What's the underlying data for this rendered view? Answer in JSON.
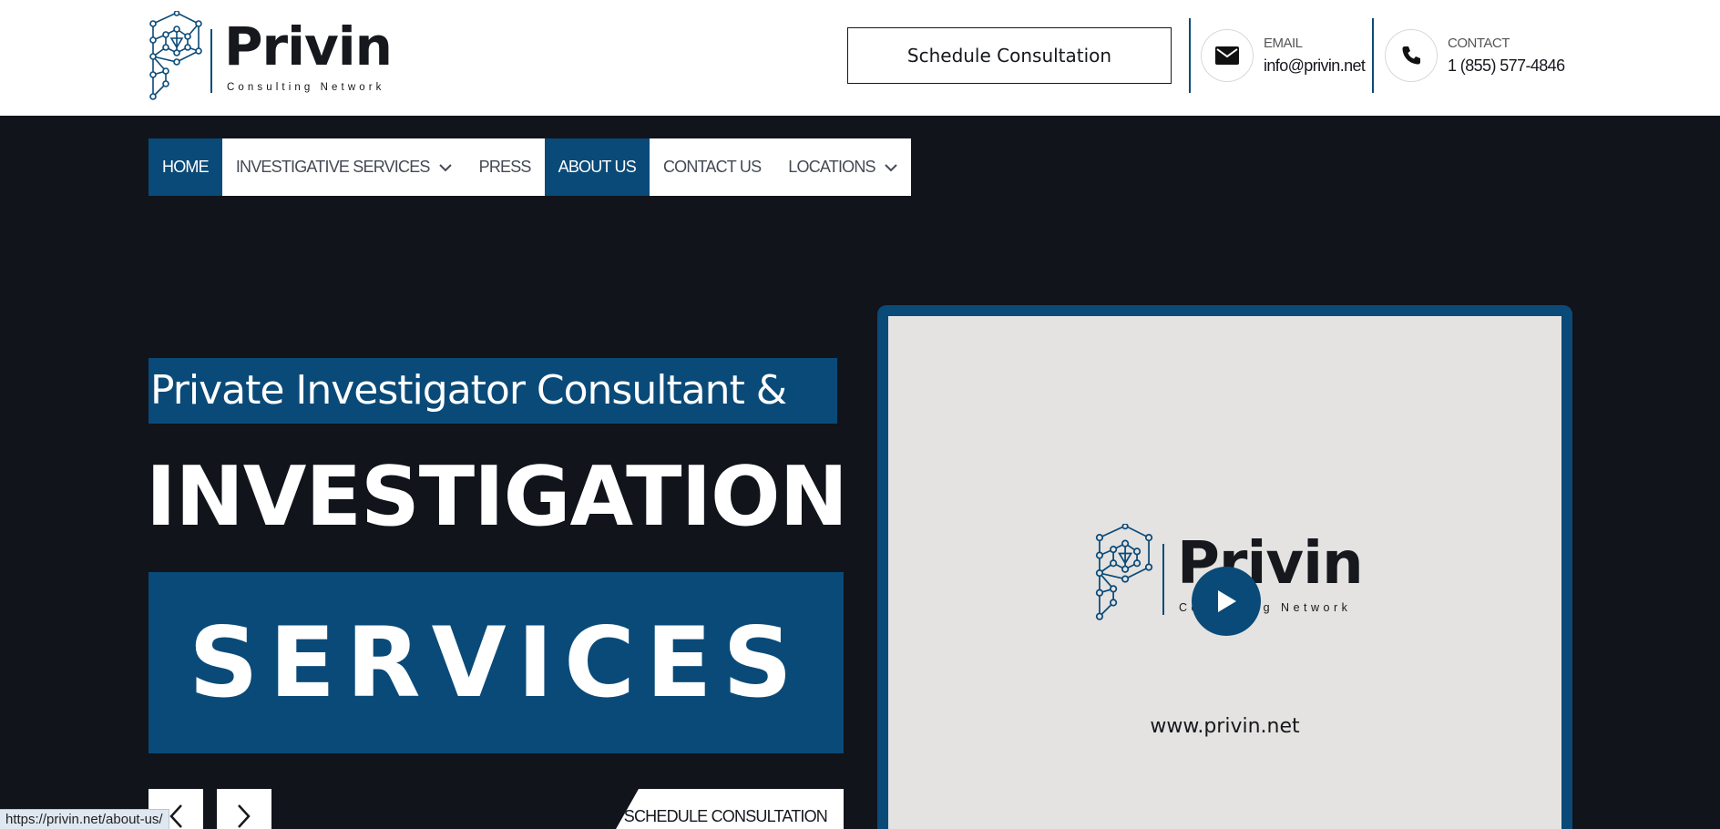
{
  "header": {
    "logo": {
      "name": "Privin",
      "tagline": "Consulting Network"
    },
    "schedule_button": "Schedule Consultation",
    "email": {
      "icon": "mail-icon",
      "label": "EMAIL",
      "value": "info@privin.net"
    },
    "contact": {
      "icon": "phone-icon",
      "label": "CONTACT",
      "value": "1 (855) 577-4846"
    }
  },
  "nav": {
    "items": [
      {
        "label": "HOME",
        "active": true,
        "dropdown": false
      },
      {
        "label": "INVESTIGATIVE SERVICES",
        "active": false,
        "dropdown": true
      },
      {
        "label": "PRESS",
        "active": false,
        "dropdown": false
      },
      {
        "label": "ABOUT US",
        "active": true,
        "dropdown": false
      },
      {
        "label": "CONTACT US",
        "active": false,
        "dropdown": false
      },
      {
        "label": "LOCATIONS",
        "active": false,
        "dropdown": true
      }
    ]
  },
  "hero": {
    "line1": "Private Investigator Consultant &",
    "line2": "INVESTIGATION",
    "line3": "SERVICES",
    "cta": "SCHEDULE CONSULTATION",
    "prev_icon": "chevron-left-icon",
    "next_icon": "chevron-right-icon"
  },
  "video": {
    "logo_name": "Privin",
    "logo_tagline": "Consulting Network",
    "url": "www.privin.net",
    "play_icon": "play-icon"
  },
  "status_url": "https://privin.net/about-us/",
  "colors": {
    "brand_blue": "#0a4a78",
    "dark_bg": "#11141b",
    "white": "#ffffff"
  }
}
